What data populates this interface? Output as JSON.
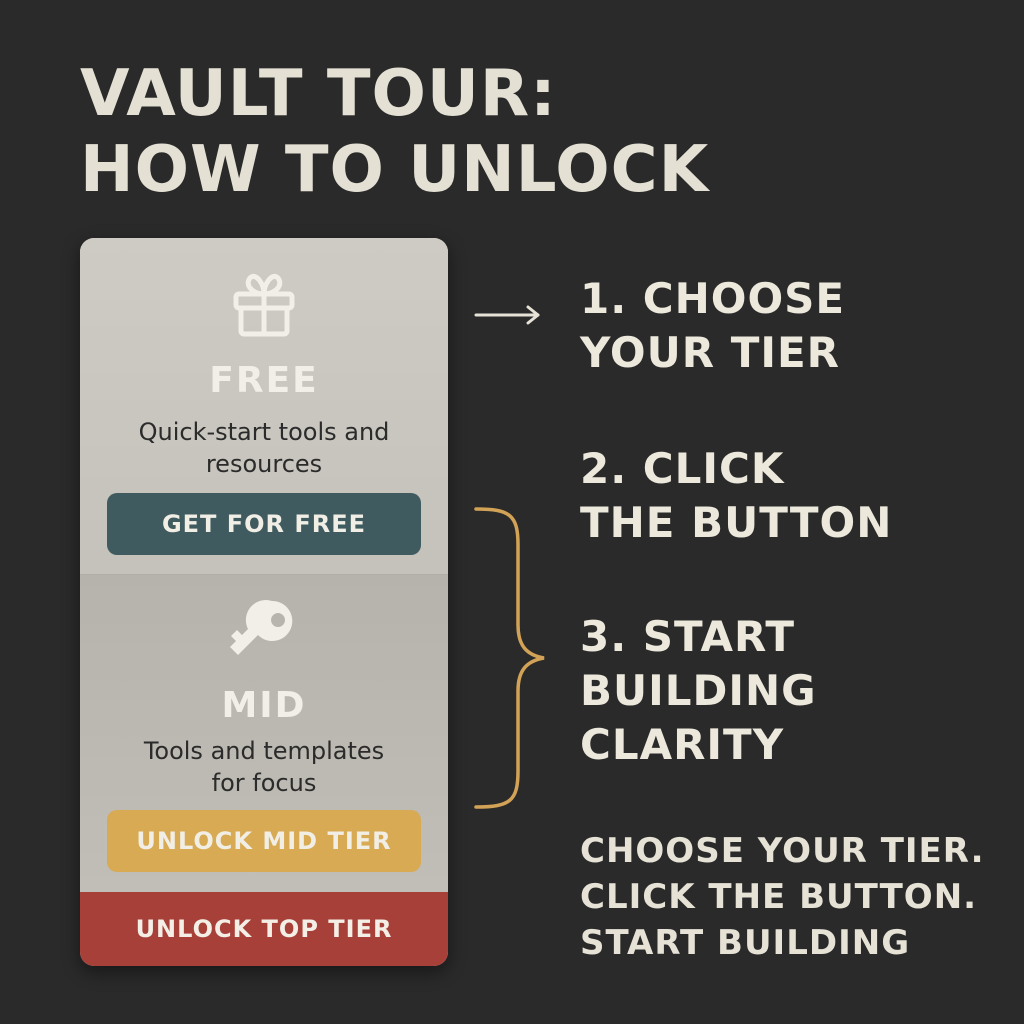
{
  "title": {
    "line1": "VAULT TOUR:",
    "line2": "HOW TO UNLOCK"
  },
  "tiers": {
    "free": {
      "icon": "gift-icon",
      "name": "FREE",
      "desc_line1": "Quick-start tools and",
      "desc_line2": "resources",
      "button": "GET FOR FREE"
    },
    "mid": {
      "icon": "key-icon",
      "name": "MID",
      "desc_line1": "Tools and templates",
      "desc_line2": "for focus",
      "button": "UNLOCK MID TIER"
    },
    "top": {
      "button": "UNLOCK TOP TIER"
    }
  },
  "steps": [
    {
      "line1": "1. CHOOSE",
      "line2": "YOUR TIER"
    },
    {
      "line1": "2. CLICK",
      "line2": "THE BUTTON"
    },
    {
      "line1": "3. START",
      "line2": "BUILDING",
      "line3": "CLARITY"
    }
  ],
  "summary": {
    "line1": "CHOOSE YOUR TIER.",
    "line2": "CLICK THE BUTTON.",
    "line3": "START BUILDING"
  },
  "colors": {
    "background": "#2a2a2a",
    "free_button": "#3f5b5f",
    "mid_button": "#d8aa53",
    "top_button": "#a8403a",
    "accent_bracket": "#d2a256"
  }
}
